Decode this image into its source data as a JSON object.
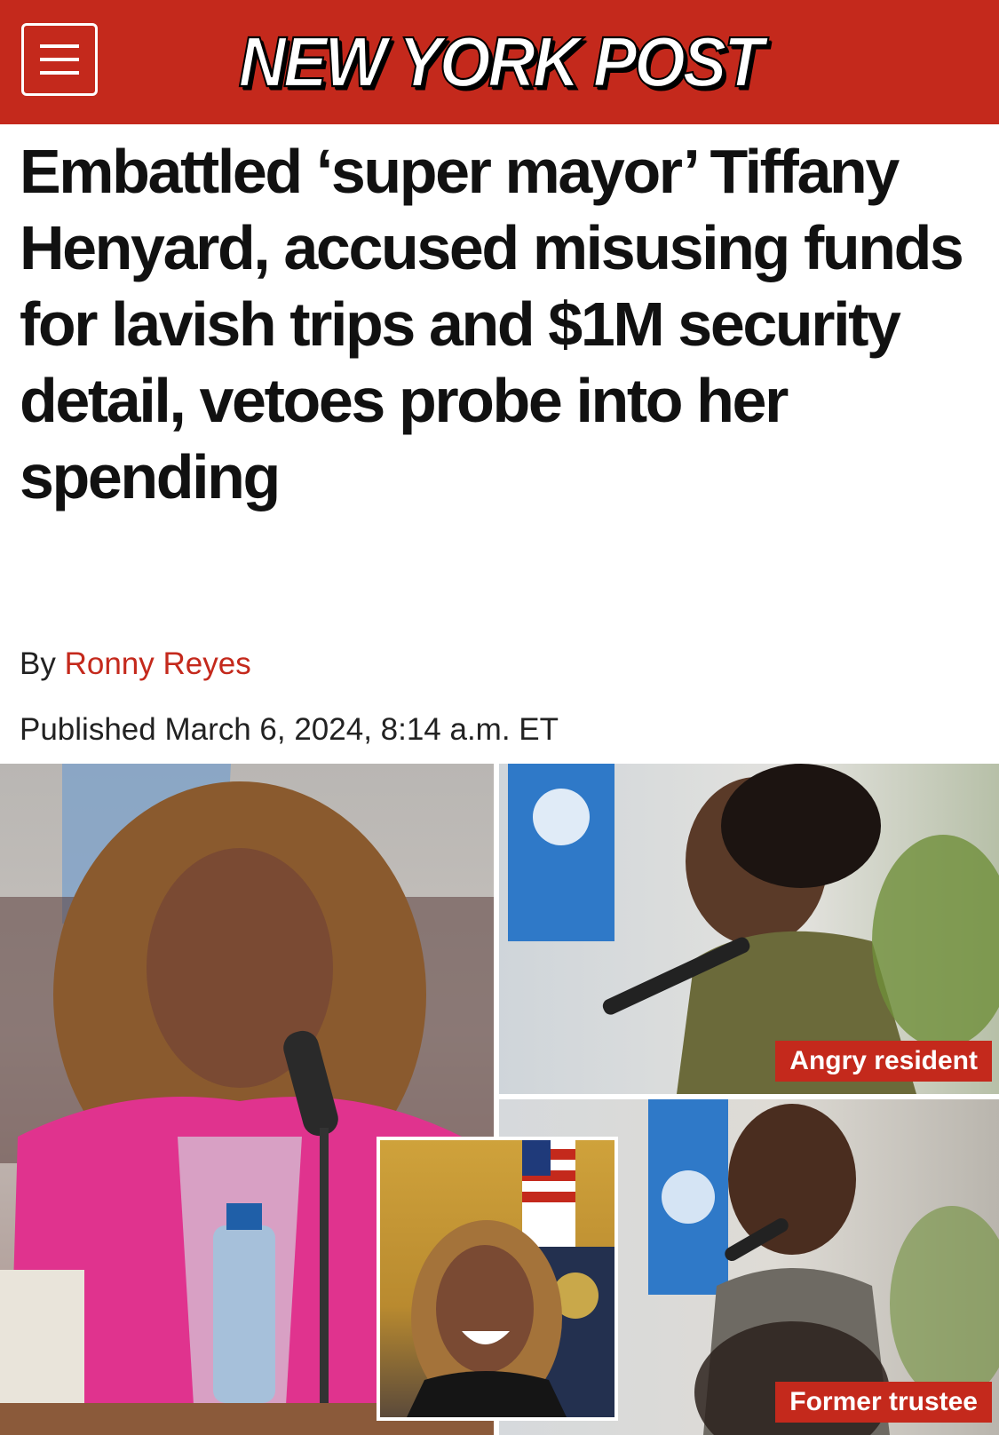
{
  "header": {
    "logo_text": "NEW YORK POST",
    "brand_color": "#c4291c",
    "menu_icon": "hamburger-menu-icon"
  },
  "article": {
    "headline": "Embattled ‘super mayor’ Tiffany Henyard, accused misusing funds for lavish trips and $1M security detail, vetoes probe into her spending",
    "byline_prefix": "By",
    "author": "Ronny Reyes",
    "published": "Published March 6, 2024, 8:14 a.m. ET"
  },
  "photo": {
    "captions": {
      "top_right": "Angry resident",
      "bottom_right": "Former trustee"
    }
  }
}
